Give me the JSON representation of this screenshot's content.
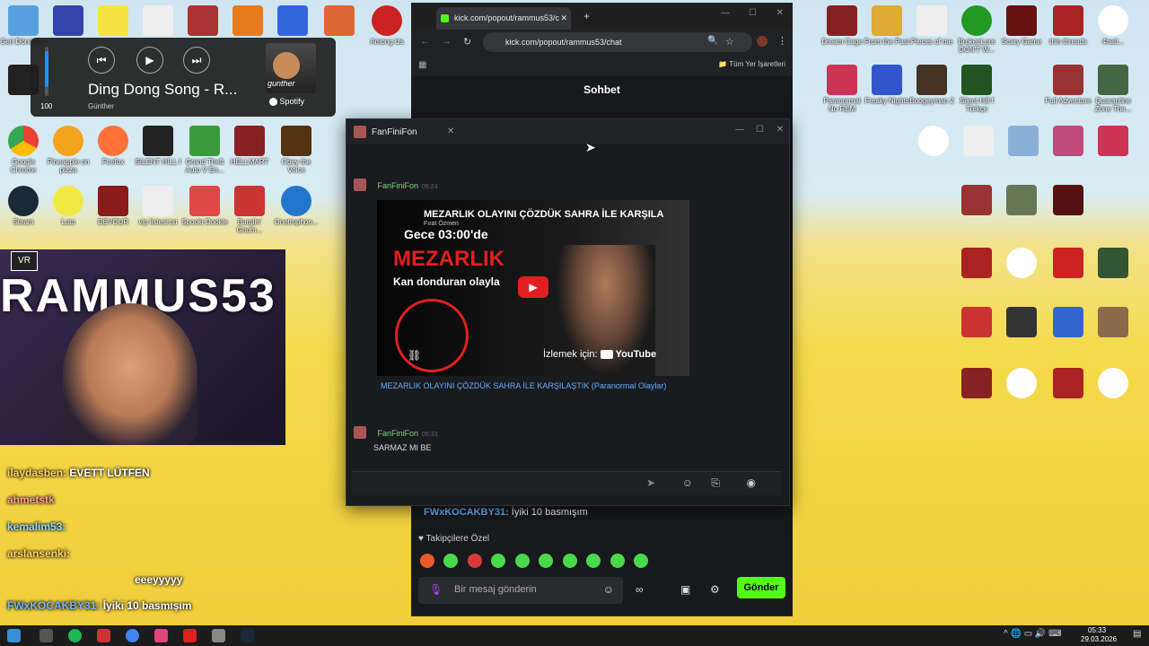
{
  "spotify": {
    "song": "Ding Dong Song - R...",
    "artist": "Günther",
    "volume": "100",
    "brand": "Spotify",
    "artist_tag": "gunther"
  },
  "browser": {
    "tab_title": "kick.com/popout/rammus53/c",
    "url": "kick.com/popout/rammus53/chat",
    "bookmarks_label": "Tüm Yer İşaretleri",
    "chat_title": "Sohbet",
    "chat_user": "FWxKOCAKBY31:",
    "chat_msg": "İyiki 10 basmışım",
    "followers_label": "Takipçilere Özel",
    "input_placeholder": "Bir mesaj gönderin",
    "send_label": "Gönder"
  },
  "popup": {
    "title": "FanFiniFon",
    "msg1_user": "FanFiniFon",
    "msg1_time": "05:24",
    "video_headline": "MEZARLIK OLAYINI ÇÖZDÜK SAHRA İLE KARŞILA",
    "video_channel": "Fırat Özmen",
    "video_time_text": "Gece 03:00'de",
    "video_big": "MEZARLIK",
    "video_sub": "Kan donduran olayla",
    "video_watch": "İzlemek için:",
    "video_yt": "YouTube",
    "link_text": "MEZARLIK OLAYINI ÇÖZDÜK SAHRA İLE KARŞILAŞTIK (Paranormal Olaylar)",
    "msg2_user": "FanFiniFon",
    "msg2_time": "05:33",
    "msg2_text": "SARMAZ MI BE"
  },
  "overlay_chat": [
    {
      "user": "ilaydasben:",
      "text": "EVETT LÜTFEN"
    },
    {
      "user": "ahmetstk",
      "text": ""
    },
    {
      "user": "kemalim53:",
      "text": ""
    },
    {
      "user": "arslansenki:",
      "text": ""
    },
    {
      "user": "",
      "text": "eeeyyyyy"
    },
    {
      "user": "FWxKOCAKBY31:",
      "text": "İyiki 10 basmışım"
    }
  ],
  "stream_banner": "RAMMUS53",
  "desktop_icons_left": [
    {
      "label": "Geri Dönüşüm",
      "color": "#5aa0e0"
    },
    {
      "label": "",
      "color": "#3344aa"
    },
    {
      "label": "",
      "color": "#f5e342"
    },
    {
      "label": "",
      "color": "#eeeeee"
    },
    {
      "label": "",
      "color": "#aa3333"
    },
    {
      "label": "",
      "color": "#e67b1e"
    },
    {
      "label": "",
      "color": "#3366dd"
    },
    {
      "label": "",
      "color": "#dd6633"
    },
    {
      "label": "Among Us",
      "color": "#cc2222"
    }
  ],
  "desktop_row2": [
    {
      "label": "Google Chrome",
      "color": "#4285f4"
    },
    {
      "label": "Pineapple on pizza",
      "color": "#f3a21b"
    },
    {
      "label": "Firefox",
      "color": "#ff7139"
    },
    {
      "label": "SILENT HILL f",
      "color": "#222222"
    },
    {
      "label": "Grand Theft Auto V En...",
      "color": "#3a9b3a"
    },
    {
      "label": "HELLMART",
      "color": "#882222"
    },
    {
      "label": "Obey the Voice",
      "color": "#553311"
    }
  ],
  "desktop_row3": [
    {
      "label": "Steam",
      "color": "#1b2838"
    },
    {
      "label": "Luto",
      "color": "#f2e842"
    },
    {
      "label": "DEVOUR",
      "color": "#8b1a1a"
    },
    {
      "label": "vip listesi.txt",
      "color": "#eeeeee"
    },
    {
      "label": "Spooki Dookie",
      "color": "#e04848"
    },
    {
      "label": "Burglin' Gnom...",
      "color": "#cc3333"
    },
    {
      "label": "Onetrophon...",
      "color": "#2277cc"
    }
  ],
  "desktop_right": [
    {
      "label": "Dream Cage",
      "color": "#882222"
    },
    {
      "label": "From the Past",
      "color": "#ddaa33"
    },
    {
      "label": "Pieces of me",
      "color": "#eeeeee"
    },
    {
      "label": "BrokenLore DON'T W...",
      "color": "#229922"
    },
    {
      "label": "Scary Game",
      "color": "#661111"
    },
    {
      "label": "thin threads",
      "color": "#aa2222"
    },
    {
      "label": "4hatt...",
      "color": "#ffffff"
    },
    {
      "label": "Paranormal No REM",
      "color": "#cc3355"
    },
    {
      "label": "Freaky Nights",
      "color": "#3355cc"
    },
    {
      "label": "Boogeyman 2",
      "color": "#443322"
    },
    {
      "label": "Silent Hill f Türkçe",
      "color": "#225522"
    },
    {
      "label": "Full Adventure",
      "color": "#993333"
    },
    {
      "label": "Quarantine Zone The...",
      "color": "#446644"
    }
  ],
  "taskbar": {
    "time": "05:33",
    "date": "29.03.2026"
  }
}
